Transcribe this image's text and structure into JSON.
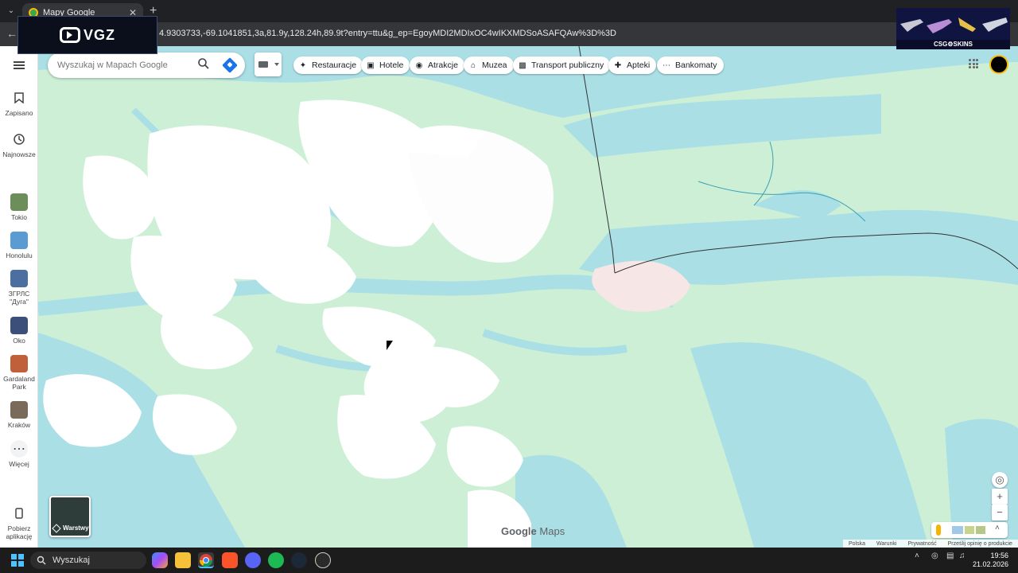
{
  "browser": {
    "tab_title": "Mapy Google",
    "url": "4.9303733,-69.1041851,3a,81.9y,128.24h,89.9t?entry=ttu&g_ep=EgoyMDI2MDIxOC4wIKXMDSoASAFQAw%3D%3D"
  },
  "overlays": {
    "vgz_logo": "VGZ",
    "csgo_brand": "CSG⚙SKINS"
  },
  "search": {
    "placeholder": "Wyszukaj w Mapach Google"
  },
  "chips": [
    {
      "label": "Restauracje",
      "icon": "fork-knife-icon"
    },
    {
      "label": "Hotele",
      "icon": "bed-icon"
    },
    {
      "label": "Atrakcje",
      "icon": "camera-icon"
    },
    {
      "label": "Muzea",
      "icon": "museum-icon"
    },
    {
      "label": "Transport publiczny",
      "icon": "bus-icon"
    },
    {
      "label": "Apteki",
      "icon": "pharmacy-icon"
    },
    {
      "label": "Bankomaty",
      "icon": "atm-icon"
    }
  ],
  "rail": {
    "saved": "Zapisano",
    "recent": "Najnowsze",
    "places": [
      {
        "label": "Tokio"
      },
      {
        "label": "Honolulu"
      },
      {
        "label": "ЗГРЛС \"Дуга\""
      },
      {
        "label": "Oko"
      },
      {
        "label": "Gardaland Park"
      },
      {
        "label": "Kraków"
      }
    ],
    "more": "Więcej",
    "get_app": "Pobierz aplikację"
  },
  "map": {
    "layers_label": "Warstwy",
    "logo_google": "Google",
    "logo_maps": "Maps",
    "footer": [
      "Polska",
      "Warunki",
      "Prywatność",
      "Prześlij opinię o produkcie"
    ]
  },
  "taskbar": {
    "search_placeholder": "Wyszukaj",
    "time": "19:56",
    "date": "21.02.2026"
  },
  "colors": {
    "water": "#aadfe6",
    "land": "#d4f1dc",
    "ice": "#ffffff",
    "accent": "#1a73e8"
  }
}
